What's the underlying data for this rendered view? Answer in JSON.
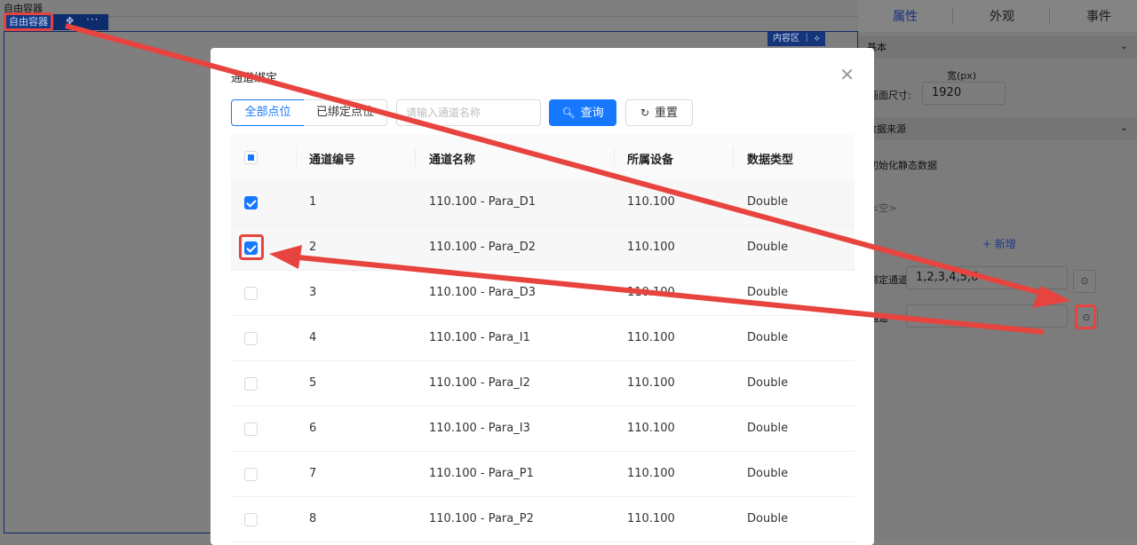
{
  "editor": {
    "top_label": "自由容器",
    "container_chip": "自由容器",
    "move_icon": "move-icon",
    "more_icon": "more-icon",
    "content_badge": "内容区 ｜ ⟡"
  },
  "panel": {
    "tabs": [
      {
        "label": "属性",
        "active": true
      },
      {
        "label": "外观",
        "active": false
      },
      {
        "label": "事件",
        "active": false
      }
    ],
    "basic_section": "基本",
    "width_label": "宽(px)",
    "page_size_label": "画面尺寸:",
    "width_value": "1920",
    "data_source_section": "数据来源",
    "init_static": "初始化静态数据",
    "empty": "<空>",
    "add_label": "+ 新增",
    "channel_label": "绑定通道",
    "channel_value": "1,2,3,4,5,6",
    "channel2_label": "通道"
  },
  "modal": {
    "title": "通道绑定",
    "close_icon": "close-icon",
    "segments": {
      "all": "全部点位",
      "bound": "已绑定点位"
    },
    "search_placeholder": "请输入通道名称",
    "query_label": "查询",
    "reset_label": "重置",
    "columns": [
      "通道编号",
      "通道名称",
      "所属设备",
      "数据类型"
    ],
    "rows": [
      {
        "checked": true,
        "id": "1",
        "name": "110.100 - Para_D1",
        "device": "110.100",
        "type": "Double"
      },
      {
        "checked": true,
        "id": "2",
        "name": "110.100 - Para_D2",
        "device": "110.100",
        "type": "Double"
      },
      {
        "checked": false,
        "id": "3",
        "name": "110.100 - Para_D3",
        "device": "110.100",
        "type": "Double"
      },
      {
        "checked": false,
        "id": "4",
        "name": "110.100 - Para_I1",
        "device": "110.100",
        "type": "Double"
      },
      {
        "checked": false,
        "id": "5",
        "name": "110.100 - Para_I2",
        "device": "110.100",
        "type": "Double"
      },
      {
        "checked": false,
        "id": "6",
        "name": "110.100 - Para_I3",
        "device": "110.100",
        "type": "Double"
      },
      {
        "checked": false,
        "id": "7",
        "name": "110.100 - Para_P1",
        "device": "110.100",
        "type": "Double"
      },
      {
        "checked": false,
        "id": "8",
        "name": "110.100 - Para_P2",
        "device": "110.100",
        "type": "Double"
      }
    ]
  },
  "colors": {
    "primary": "#1677ff",
    "annotation": "#e8443f"
  }
}
